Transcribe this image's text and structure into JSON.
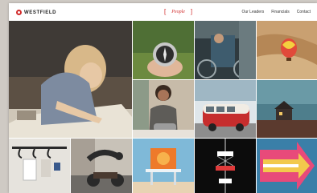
{
  "brand": {
    "name": "WESTFIELD"
  },
  "nav": {
    "active_tab": "People",
    "links": [
      "Our Leaders",
      "Financials",
      "Contact"
    ]
  },
  "photos": [
    "woman-drawing-on-paper",
    "hand-holding-compass",
    "cyclist-carrying-bike",
    "hot-air-balloon-over-desert",
    "smiling-woman-in-kitchen",
    "red-vw-van",
    "lone-house-at-dusk",
    "coat-hooks-and-wall-items",
    "person-leaping-over-motorbike",
    "orange-lifeguard-tower",
    "hanging-light-installation",
    "painted-arrow-sign"
  ],
  "colors": {
    "accent": "#d12b2b"
  }
}
